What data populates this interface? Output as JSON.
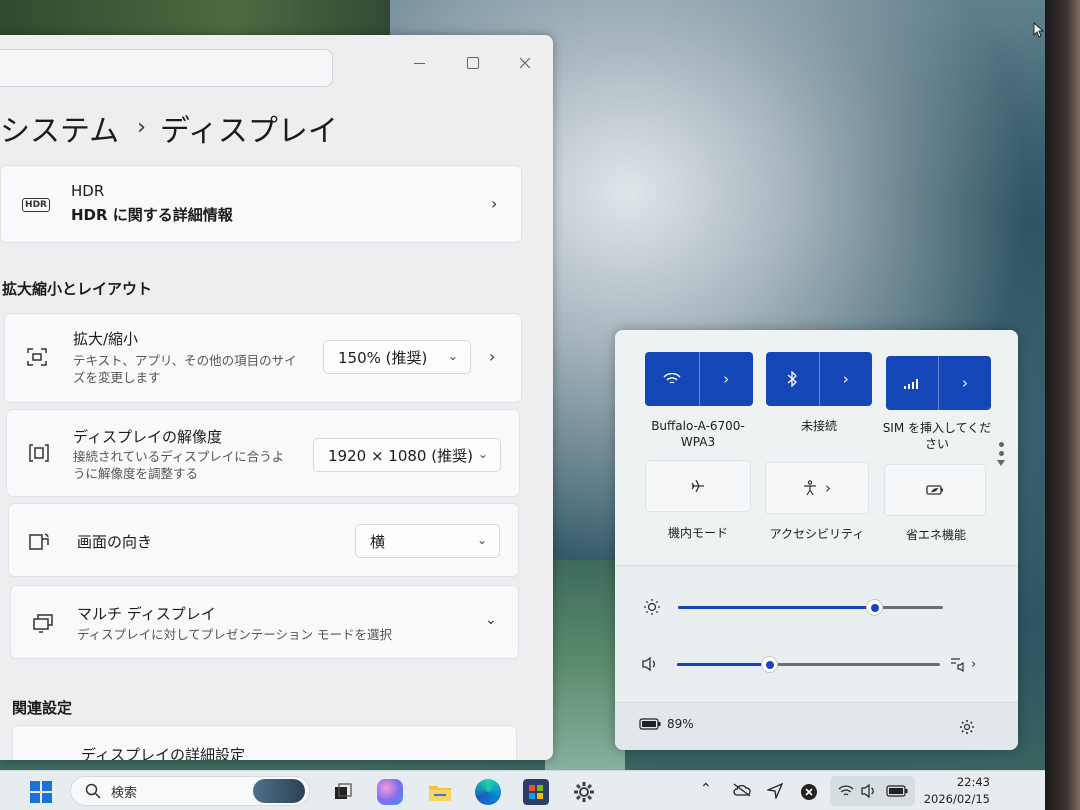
{
  "settings": {
    "breadcrumb_parent": "システム",
    "breadcrumb_sep": "›",
    "breadcrumb_current": "ディスプレイ",
    "hdr": {
      "badge": "HDR",
      "title": "HDR",
      "link": "HDR に関する詳細情報"
    },
    "section_scale": "拡大縮小とレイアウト",
    "scale": {
      "title": "拡大/縮小",
      "desc": "テキスト、アプリ、その他の項目のサイズを変更します",
      "value": "150% (推奨)"
    },
    "resolution": {
      "title": "ディスプレイの解像度",
      "desc": "接続されているディスプレイに合うように解像度を調整する",
      "value": "1920 × 1080 (推奨)"
    },
    "orientation": {
      "title": "画面の向き",
      "value": "横"
    },
    "multi_display": {
      "title": "マルチ ディスプレイ",
      "desc": "ディスプレイに対してプレゼンテーション モードを選択"
    },
    "section_related": "関連設定",
    "advanced": {
      "title": "ディスプレイの詳細設定"
    }
  },
  "quick_settings": {
    "wifi_label": "Buffalo-A-6700-WPA3",
    "bluetooth_label": "未接続",
    "cellular_label": "SIM を挿入してください",
    "airplane_label": "機内モード",
    "accessibility_label": "アクセシビリティ",
    "energy_saver_label": "省エネ機能",
    "brightness_level": 0.74,
    "volume_level": 0.35,
    "battery_percent": "89%",
    "accent_color": "#1546b8"
  },
  "taskbar": {
    "search_placeholder": "検索",
    "time": "22:43",
    "date": "2026/02/15"
  }
}
